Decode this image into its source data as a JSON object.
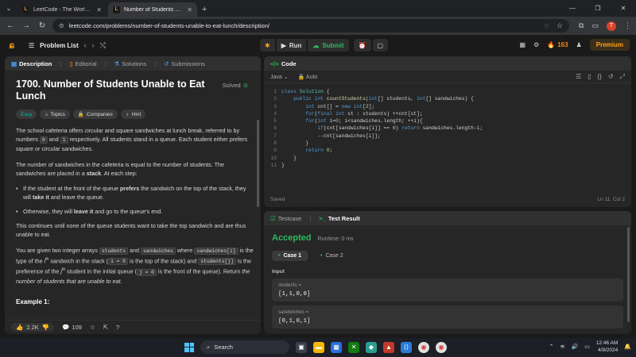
{
  "browser": {
    "tabs": [
      {
        "title": "LeetCode - The World's Leading",
        "favicon": "leetcode-favicon"
      },
      {
        "title": "Number of Students Unable to",
        "favicon": "leetcode-favicon"
      }
    ],
    "url": "leetcode.com/problems/number-of-students-unable-to-eat-lunch/description/",
    "profile_initial": "T"
  },
  "nav": {
    "problem_list": "Problem List",
    "run": "Run",
    "submit": "Submit",
    "streak": "163",
    "premium": "Premium"
  },
  "left_tabs": {
    "description": "Description",
    "editorial": "Editorial",
    "solutions": "Solutions",
    "submissions": "Submissions"
  },
  "problem": {
    "title": "1700. Number of Students Unable to Eat Lunch",
    "status": "Solved",
    "tags": [
      "Easy",
      "Topics",
      "Companies",
      "Hint"
    ],
    "p1a": "The school cafeteria offers circular and square sandwiches at lunch break, referred to by numbers ",
    "p1_code0": "0",
    "p1b": " and ",
    "p1_code1": "1",
    "p1c": " respectively. All students stand in a queue. Each student either prefers square or circular sandwiches.",
    "p2a": "The number of sandwiches in the cafeteria is equal to the number of students. The sandwiches are placed in a ",
    "p2_bold": "stack",
    "p2b": ". At each step:",
    "b1a": "If the student at the front of the queue ",
    "b1_bold1": "prefers",
    "b1b": " the sandwich on the top of the stack, they will ",
    "b1_bold2": "take it",
    "b1c": " and leave the queue.",
    "b2a": "Otherwise, they will ",
    "b2_bold": "leave it",
    "b2b": " and go to the queue's end.",
    "p3": "This continues until none of the queue students want to take the top sandwich and are thus unable to eat.",
    "p4a": "You are given two integer arrays ",
    "p4_c1": "students",
    "p4b": " and ",
    "p4_c2": "sandwiches",
    "p4c": " where ",
    "p4_c3": "sandwiches[i]",
    "p4d": " is the type of the ",
    "p4_i1": "i",
    "p4_sup": "th",
    "p4e": " sandwich in the stack (",
    "p4_c4": "i = 0",
    "p4f": " is the top of the stack) and ",
    "p4_c5": "students[j]",
    "p4g": " is the preference of the ",
    "p4_j": "j",
    "p4_sup2": "th",
    "p4h": " student in the initial queue (",
    "p4_c6": "j = 0",
    "p4i": " is the front of the queue). Return ",
    "p4_em": "the number of students that are unable to eat.",
    "example": "Example 1:",
    "likes": "2.2K",
    "comments": "109"
  },
  "code": {
    "header": "Code",
    "language": "Java",
    "mode": "Auto",
    "lines": [
      "class Solution {",
      "    public int countStudents(int[] students, int[] sandwiches) {",
      "        int cnt[] = new int[2];",
      "        for(final int st : students) ++cnt[st];",
      "        for(int i=0; i<sandwiches.length; ++i){",
      "            if(cnt[sandwiches[i]] == 0) return sandwiches.length-i;",
      "            --cnt[sandwiches[i]];",
      "        }",
      "        return 0;",
      "    }",
      "}"
    ],
    "saved": "Saved",
    "cursor": "Ln 11, Col 2"
  },
  "test": {
    "tab_testcase": "Testcase",
    "tab_result": "Test Result",
    "verdict": "Accepted",
    "runtime": "Runtime: 0 ms",
    "cases": [
      "Case 1",
      "Case 2"
    ],
    "input_label": "Input",
    "vars": [
      {
        "name": "students =",
        "value": "[1,1,0,0]"
      },
      {
        "name": "sandwiches =",
        "value": "[0,1,0,1]"
      }
    ]
  },
  "taskbar": {
    "search": "Search",
    "time": "12:46 AM",
    "date": "4/9/2024"
  }
}
